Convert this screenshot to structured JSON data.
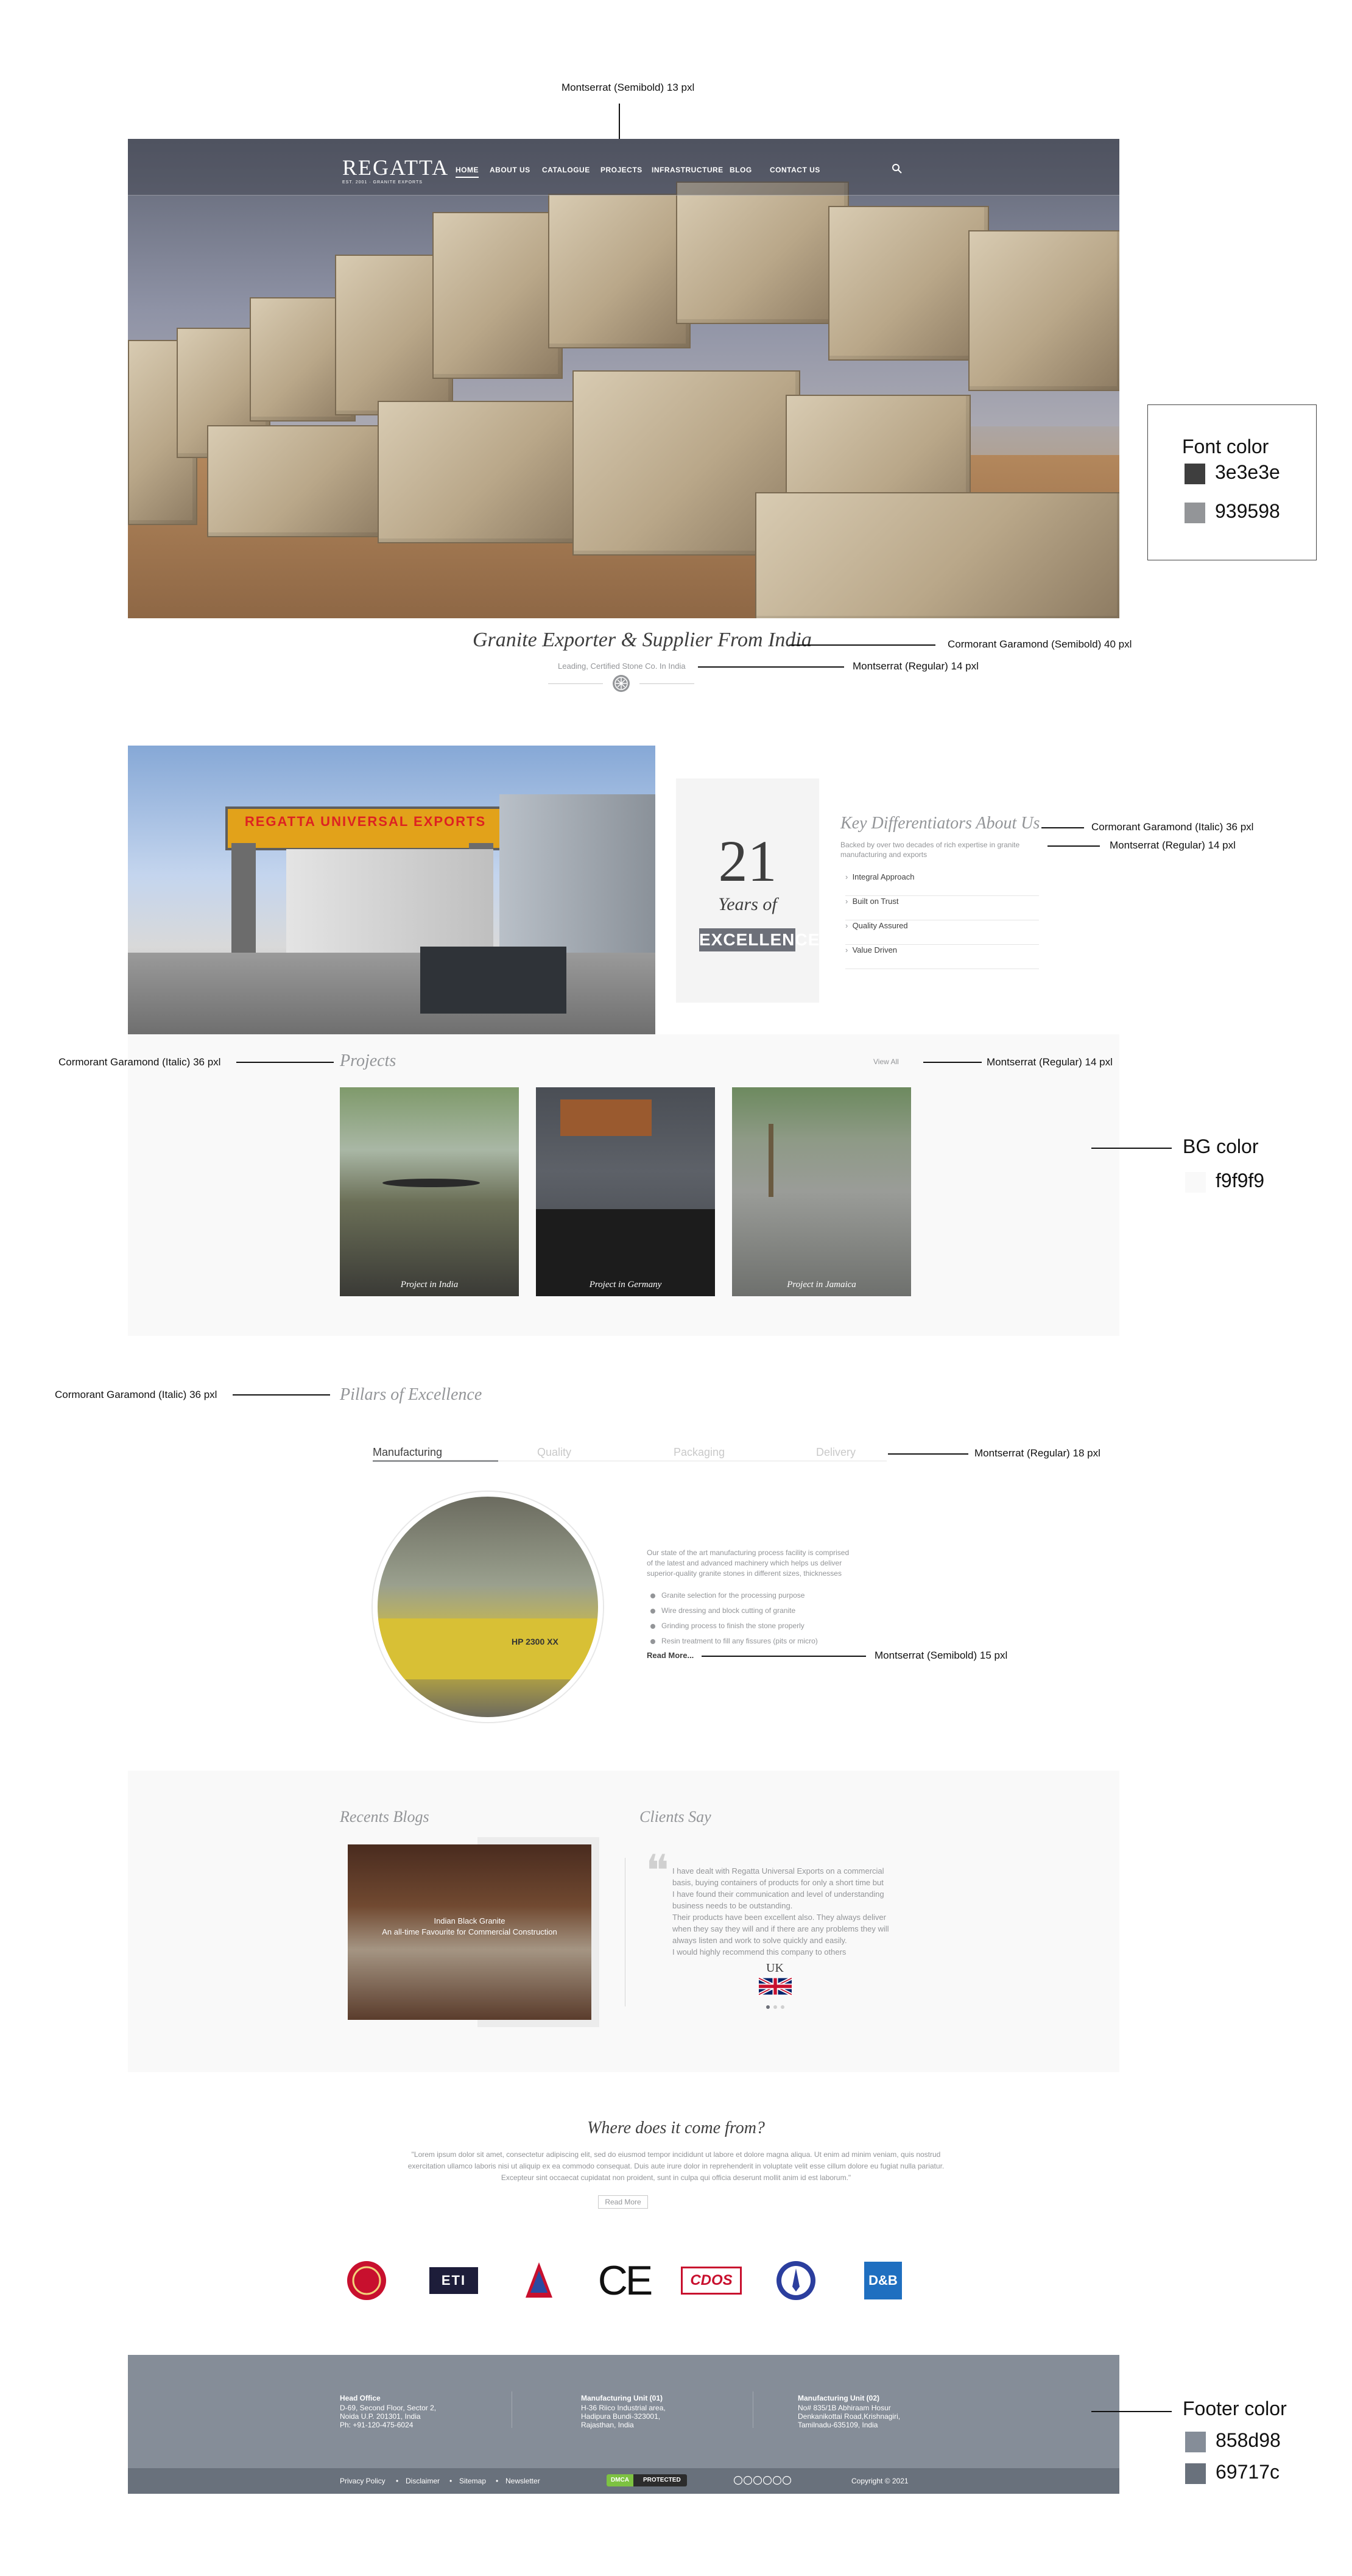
{
  "annotations": {
    "nav_font": "Montserrat (Semibold) 13 pxl",
    "hero_title_font": "Cormorant Garamond (Semibold) 40 pxl",
    "hero_sub_font": "Montserrat (Regular) 14 pxl",
    "diff_title_font": "Cormorant Garamond (Italic) 36 pxl",
    "diff_sub_font": "Montserrat (Regular) 14 pxl",
    "projects_title_font": "Cormorant Garamond (Italic) 36 pxl",
    "view_all_font": "Montserrat (Regular) 14 pxl",
    "pillars_title_font": "Cormorant Garamond (Italic) 36 pxl",
    "tabs_font": "Montserrat (Regular) 18 pxl",
    "read_more_font": "Montserrat (Semibold) 15 pxl",
    "font_color_label": "Font color",
    "font_colors": [
      "3e3e3e",
      "939598"
    ],
    "bg_color_label": "BG color",
    "bg_color": "f9f9f9",
    "footer_color_label": "Footer color",
    "footer_colors": [
      "858d98",
      "69717c"
    ]
  },
  "colors": {
    "text_dark": "#3e3e3e",
    "text_grey": "#939598",
    "bg_light": "#f9f9f9",
    "footer": "#858d98",
    "footer_bar": "#69717c"
  },
  "header": {
    "logo": "REGATTA",
    "logo_sub": "EST. 2001 · GRANITE EXPORTS",
    "nav": [
      "HOME",
      "ABOUT US",
      "CATALOGUE",
      "PROJECTS",
      "INFRASTRUCTURE",
      "BLOG",
      "CONTACT US"
    ],
    "search_icon": "search-icon"
  },
  "hero": {
    "title": "Granite Exporter & Supplier From India",
    "subtitle": "Leading, Certified Stone Co. In India"
  },
  "about": {
    "sign_text": "REGATTA UNIVERSAL EXPORTS",
    "years_number": "21",
    "years_of": "Years of",
    "excellence": "EXCELLENCE",
    "title": "Key Differentiators About Us",
    "sub_line1": "Backed by over two decades of rich expertise in granite",
    "sub_line2": "manufacturing and exports",
    "items": [
      "Integral Approach",
      "Built on Trust",
      "Quality Assured",
      "Value Driven"
    ]
  },
  "projects": {
    "title": "Projects",
    "view_all": "View All",
    "items": [
      "Project in India",
      "Project in Germany",
      "Project in Jamaica"
    ]
  },
  "pillars": {
    "title": "Pillars of Excellence",
    "tabs": [
      "Manufacturing",
      "Quality",
      "Packaging",
      "Delivery"
    ],
    "machine_label": "HP 2300 XX",
    "para1": "Our state of the art manufacturing process facility is comprised",
    "para2": "of the latest and advanced machinery which helps us deliver",
    "para3": "superior-quality granite stones in different sizes, thicknesses",
    "bullets": [
      "Granite selection for the processing purpose",
      "Wire dressing and block cutting of granite",
      "Grinding process to finish the stone properly",
      "Resin treatment to fill any fissures (pits or micro)"
    ],
    "read_more": "Read More..."
  },
  "blogs": {
    "title": "Recents Blogs",
    "post_title": "Indian Black Granite",
    "post_sub": "An all-time Favourite for Commercial Construction"
  },
  "testimonial": {
    "title": "Clients Say",
    "lines": [
      "I have dealt with Regatta Universal Exports on a commercial",
      "basis, buying containers of products for only a short time but",
      "I have found their communication and level of understanding",
      "business needs to be outstanding.",
      "Their products have been excellent also. They always deliver",
      "when they say they will and if there are any problems they will",
      "always listen and work to solve quickly and easily.",
      "I would highly recommend this company to others"
    ],
    "country": "UK"
  },
  "where": {
    "title": "Where does it come from?",
    "line1": "\"Lorem ipsum dolor sit amet, consectetur adipiscing elit, sed do eiusmod tempor incididunt ut labore et dolore magna aliqua. Ut enim ad minim veniam, quis nostrud",
    "line2": "exercitation ullamco laboris nisi ut aliquip ex ea commodo consequat. Duis aute irure dolor in reprehenderit in voluptate velit esse cillum dolore eu fugiat nulla pariatur.",
    "line3": "Excepteur sint occaecat cupidatat non proident, sunt in culpa qui officia deserunt mollit anim id est laborum.\"",
    "button": "Read More"
  },
  "certs": [
    "ETI",
    "CE",
    "CDOS",
    "D&B"
  ],
  "footer": {
    "head_office": {
      "title": "Head Office",
      "lines": [
        "D-69, Second Floor, Sector 2,",
        "Noida U.P. 201301, India",
        "Ph: +91-120-475-6024"
      ]
    },
    "unit1": {
      "title": "Manufacturing Unit (01)",
      "lines": [
        "H-36 Riico Industrial area,",
        "Hadipura Bundi-323001,",
        "Rajasthan, India"
      ]
    },
    "unit2": {
      "title": "Manufacturing Unit (02)",
      "lines": [
        "No# 835/1B Abhiraam Hosur",
        "Denkanikottai Road,Krishnagiri,",
        "Tamilnadu-635109, India"
      ]
    },
    "links": [
      "Privacy Policy",
      "Disclaimer",
      "Sitemap",
      "Newsletter"
    ],
    "dmca_left": "DMCA",
    "dmca_right": "PROTECTED",
    "copyright": "Copyright © 2021"
  }
}
